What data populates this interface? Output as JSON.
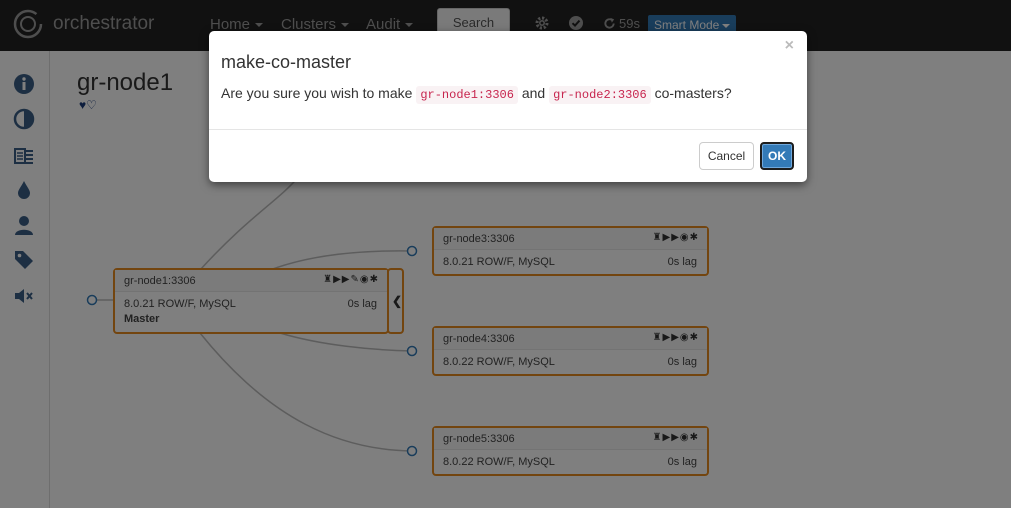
{
  "navbar": {
    "brand": "orchestrator",
    "menu": [
      {
        "label": "Home"
      },
      {
        "label": "Clusters"
      },
      {
        "label": "Audit"
      }
    ],
    "search_label": "Search",
    "refresh_countdown": "59s",
    "smart_mode_label": "Smart Mode"
  },
  "sidebar": {
    "icons": [
      "info-icon",
      "contrast-icon",
      "instances-icon",
      "drop-icon",
      "user-icon",
      "tag-icon",
      "mute-icon"
    ]
  },
  "page": {
    "title": "gr-node1",
    "hearts": "♥♡"
  },
  "nodes": [
    {
      "name": "gr-node1:3306",
      "tools": "♜▶▶✎◉✱",
      "version": "8.0.21 ROW/F, MySQL",
      "lag": "0s lag",
      "role": "Master"
    },
    {
      "name": "gr-node3:3306",
      "tools": "♜▶▶◉✱",
      "version": "8.0.21 ROW/F, MySQL",
      "lag": "0s lag"
    },
    {
      "name": "gr-node4:3306",
      "tools": "♜▶▶◉✱",
      "version": "8.0.22 ROW/F, MySQL",
      "lag": "0s lag"
    },
    {
      "name": "gr-node5:3306",
      "tools": "♜▶▶◉✱",
      "version": "8.0.22 ROW/F, MySQL",
      "lag": "0s lag"
    }
  ],
  "modal": {
    "close": "×",
    "title": "make-co-master",
    "text_before": "Are you sure you wish to make ",
    "host_a": "gr-node1:3306",
    "text_and": " and ",
    "host_b": "gr-node2:3306",
    "text_after": " co-masters?",
    "cancel_label": "Cancel",
    "ok_label": "OK"
  },
  "colors": {
    "navbar": "#222222",
    "node_border": "#e68a1f",
    "accent": "#337ab7",
    "code_text": "#c7254e"
  }
}
